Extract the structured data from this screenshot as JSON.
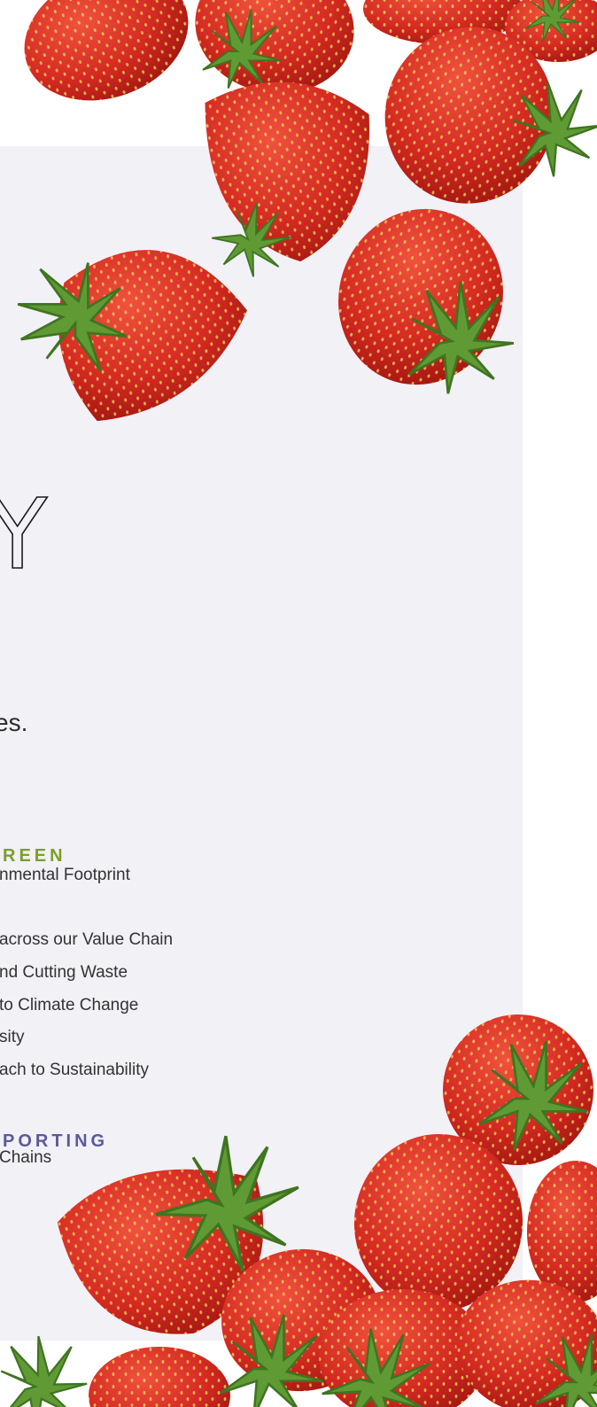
{
  "hero": {
    "title_fragment": "Y",
    "intro_tail": "es."
  },
  "green_section": {
    "heading": "REEN",
    "items": [
      "nmental Footprint",
      "across our Value Chain",
      "nd Cutting Waste",
      "to Climate Change",
      "sity",
      "ach to Sustainability"
    ]
  },
  "reporting_section": {
    "heading": "PORTING",
    "items": [
      "Chains"
    ]
  },
  "colors": {
    "panel": "#f1f1f6",
    "green_heading": "#7d9e2c",
    "reporting_heading": "#5a5a9a",
    "strawberry": "#d42a22"
  }
}
